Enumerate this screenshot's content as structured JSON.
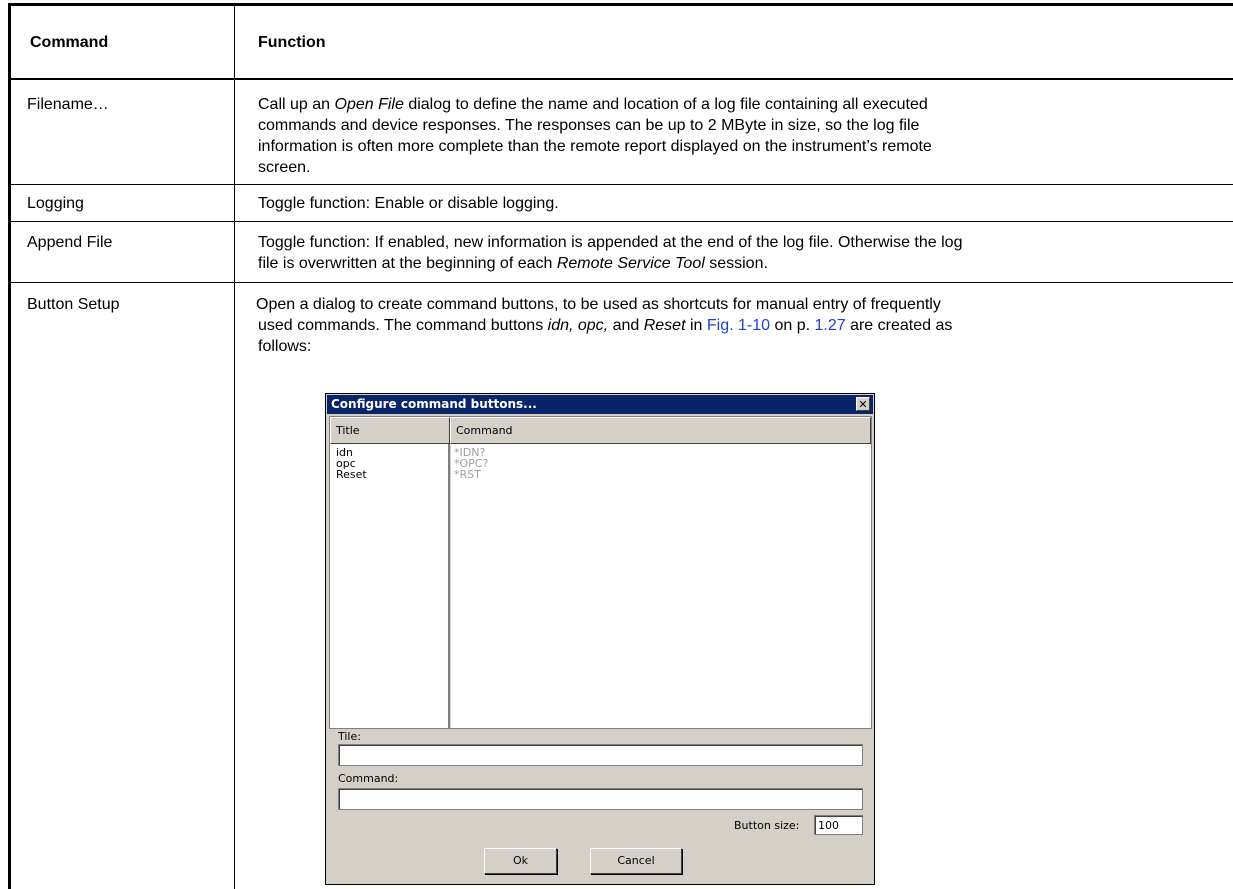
{
  "table": {
    "headers": {
      "command": "Command",
      "function": "Function"
    },
    "rows": [
      {
        "command": "Filename…",
        "function_lines": [
          "Call up an Open File dialog to define the name and location of a log file containing all executed",
          "commands and device responses. The responses can be up to 2 MByte in size, so the log file",
          "information is often more complete than the remote report displayed on the instrument’s remote",
          "screen."
        ]
      },
      {
        "command": "Logging",
        "function_lines": [
          "Toggle function: Enable or disable logging."
        ]
      },
      {
        "command": "Append File",
        "function_lines": [
          "Toggle function: If enabled, new information is appended at the end of the log file. Otherwise the log",
          "file is overwritten at the beginning of each Remote Service Tool session."
        ]
      },
      {
        "command": "Button Setup",
        "function_parts": {
          "l1": "Open a dialog to create command buttons, to be used as shortcuts for manual entry of frequently",
          "l2a": "used commands. The command buttons ",
          "l2b": "idn, opc,",
          "l2c": " and ",
          "l2d": "Reset",
          "l2e": " in ",
          "l2f": "Fig. 1-10",
          "l2g": " on p. ",
          "l2h": "1.27",
          "l2i": " are created as",
          "l3": "follows:"
        }
      }
    ]
  },
  "dialog": {
    "title": "Configure command buttons...",
    "close_glyph": "✕",
    "columns": {
      "title": "Title",
      "command": "Command"
    },
    "entries": [
      {
        "title": "idn",
        "command": "*IDN?"
      },
      {
        "title": "opc",
        "command": "*OPC?"
      },
      {
        "title": "Reset",
        "command": "*RST"
      }
    ],
    "tile_label": "Tile:",
    "tile_value": "",
    "command_label": "Command:",
    "command_value": "",
    "button_size_label": "Button size:",
    "button_size_value": "100",
    "ok_label": "Ok",
    "cancel_label": "Cancel"
  },
  "colors": {
    "link": "#1f3fd0",
    "titlebar": "#0a246a",
    "dialog_face": "#d4d0c8"
  }
}
